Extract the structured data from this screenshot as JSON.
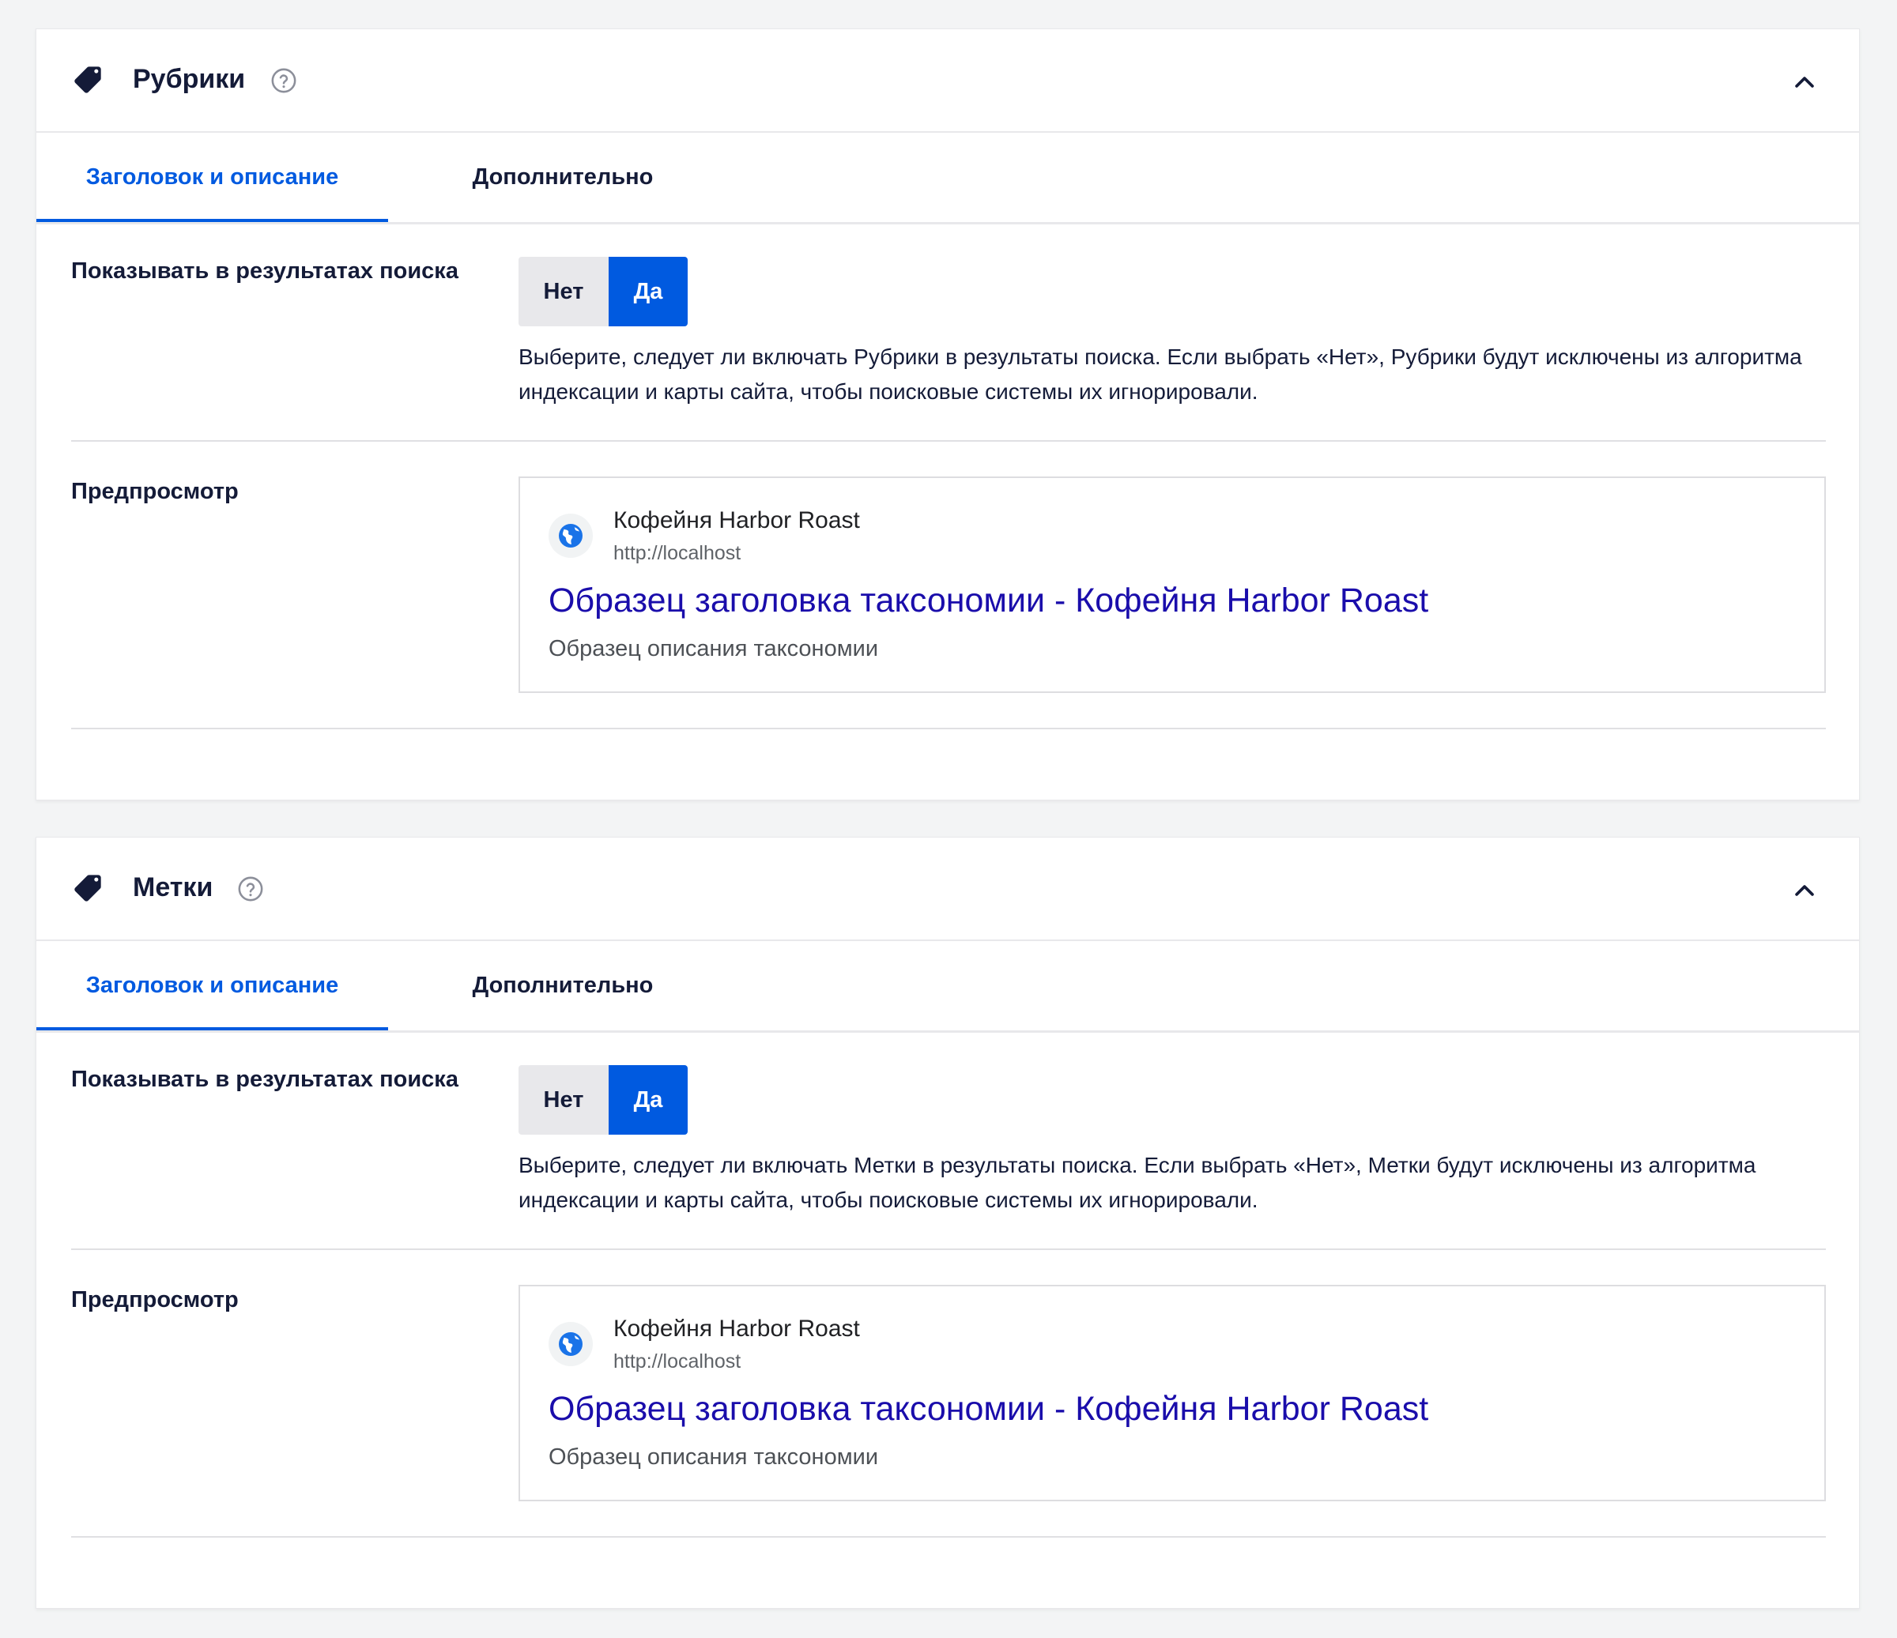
{
  "sections": [
    {
      "title": "Рубрики",
      "tabs": [
        "Заголовок и описание",
        "Дополнительно"
      ],
      "show_in_search": {
        "label": "Показывать в результатах поиска",
        "option_no": "Нет",
        "option_yes": "Да",
        "selected": "Да",
        "description": "Выберите, следует ли включать Рубрики в результаты поиска. Если выбрать «Нет», Рубрики будут исключены из алгоритма индексации и карты сайта, чтобы поисковые системы их игнорировали."
      },
      "preview": {
        "label": "Предпросмотр",
        "site_name": "Кофейня Harbor Roast",
        "url": "http://localhost",
        "title": "Образец заголовка таксономии - Кофейня Harbor Roast",
        "description": "Образец описания таксономии"
      }
    },
    {
      "title": "Метки",
      "tabs": [
        "Заголовок и описание",
        "Дополнительно"
      ],
      "show_in_search": {
        "label": "Показывать в результатах поиска",
        "option_no": "Нет",
        "option_yes": "Да",
        "selected": "Да",
        "description": "Выберите, следует ли включать Метки в результаты поиска. Если выбрать «Нет», Метки будут исключены из алгоритма индексации и карты сайта, чтобы поисковые системы их игнорировали."
      },
      "preview": {
        "label": "Предпросмотр",
        "site_name": "Кофейня Harbor Roast",
        "url": "http://localhost",
        "title": "Образец заголовка таксономии - Кофейня Harbor Roast",
        "description": "Образец описания таксономии"
      }
    }
  ],
  "icons": {
    "section": "tag-icon",
    "help": "help-circle-icon",
    "collapse": "chevron-up-icon",
    "favicon": "globe-icon"
  },
  "colors": {
    "accent": "#005ae0",
    "text": "#141b38",
    "link": "#1a0dab",
    "background": "#f3f4f5"
  }
}
